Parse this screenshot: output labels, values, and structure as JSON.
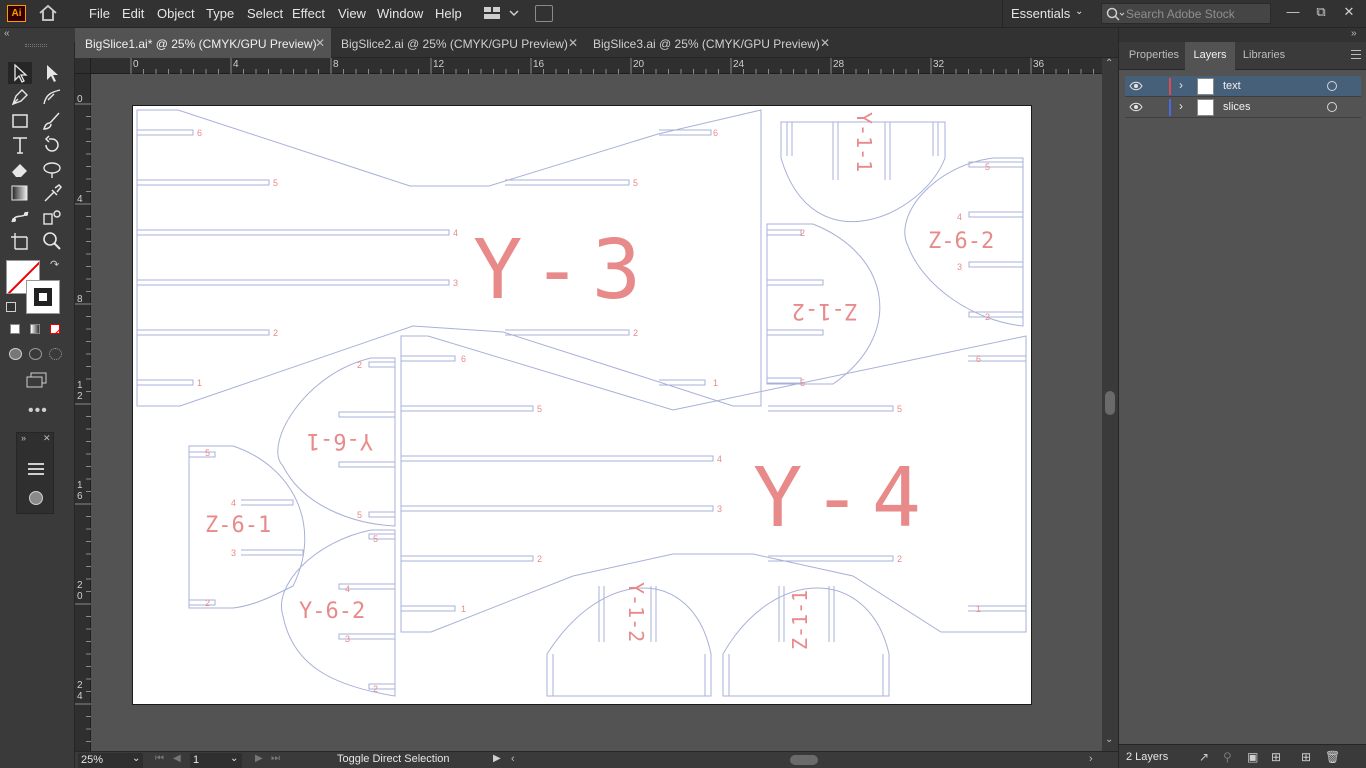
{
  "app": {
    "logo": "Ai"
  },
  "menu": [
    "File",
    "Edit",
    "Object",
    "Type",
    "Select",
    "Effect",
    "View",
    "Window",
    "Help"
  ],
  "workspace": {
    "label": "Essentials"
  },
  "stock_search": {
    "placeholder": "Search Adobe Stock"
  },
  "tabs": [
    {
      "label": "BigSlice1.ai* @ 25% (CMYK/GPU Preview)",
      "active": true
    },
    {
      "label": "BigSlice2.ai @ 25% (CMYK/GPU Preview)",
      "active": false
    },
    {
      "label": "BigSlice3.ai @ 25% (CMYK/GPU Preview)",
      "active": false
    }
  ],
  "ruler": {
    "h_labels": [
      "0",
      "4",
      "8",
      "12",
      "16",
      "20",
      "24",
      "28",
      "32",
      "36"
    ],
    "v_labels": [
      "0",
      "4",
      "8",
      "12",
      "16",
      "20",
      "24"
    ]
  },
  "artwork": {
    "slice_labels": [
      "Y-3",
      "Y-4",
      "Z-6-2",
      "Z-1-2",
      "Y-6-1",
      "Z-6-1",
      "Y-6-2",
      "Y-1-1",
      "Y-1-2",
      "Z-1-1"
    ],
    "slot_numbers": [
      "1",
      "2",
      "3",
      "4",
      "5",
      "6"
    ]
  },
  "status": {
    "zoom": "25%",
    "artboard": "1",
    "message": "Toggle Direct Selection"
  },
  "panel": {
    "tabs": [
      "Properties",
      "Layers",
      "Libraries"
    ],
    "active_tab": "Layers",
    "layers": [
      {
        "name": "text",
        "color": "#e04a4a",
        "selected": true
      },
      {
        "name": "slices",
        "color": "#4a6ae0",
        "selected": false
      }
    ],
    "layer_count": "2 Layers"
  }
}
